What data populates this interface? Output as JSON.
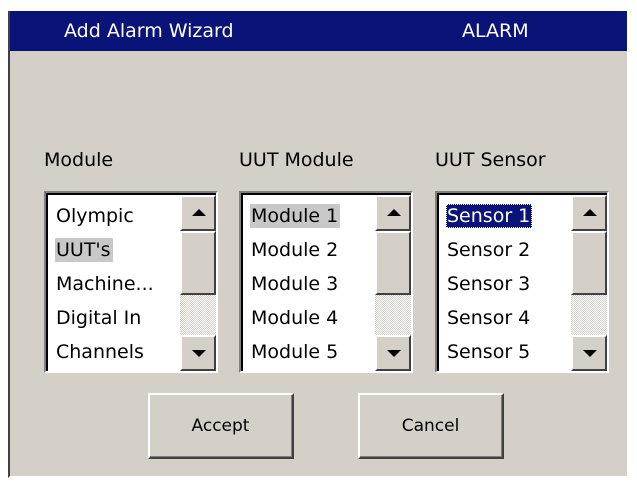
{
  "window": {
    "title": "Add Alarm Wizard",
    "tag": "ALARM"
  },
  "columns": [
    {
      "label": "Module",
      "items": [
        "Olympic",
        "UUT's",
        "Machine...",
        "Digital In",
        "Channels"
      ],
      "selected_index": 1
    },
    {
      "label": "UUT Module",
      "items": [
        "Module 1",
        "Module 2",
        "Module 3",
        "Module 4",
        "Module 5"
      ],
      "selected_index": 0
    },
    {
      "label": "UUT Sensor",
      "items": [
        "Sensor 1",
        "Sensor 2",
        "Sensor 3",
        "Sensor 4",
        "Sensor 5"
      ],
      "selected_index": 0
    }
  ],
  "buttons": {
    "accept": "Accept",
    "cancel": "Cancel"
  },
  "colors": {
    "title_bar": "#0a1378",
    "dialog_bg": "#d4d0c8",
    "focus_selection": "#0a1378",
    "inactive_selection": "#c8c8c8"
  },
  "icons": {
    "scroll_up": "triangle-up-icon",
    "scroll_down": "triangle-down-icon"
  }
}
